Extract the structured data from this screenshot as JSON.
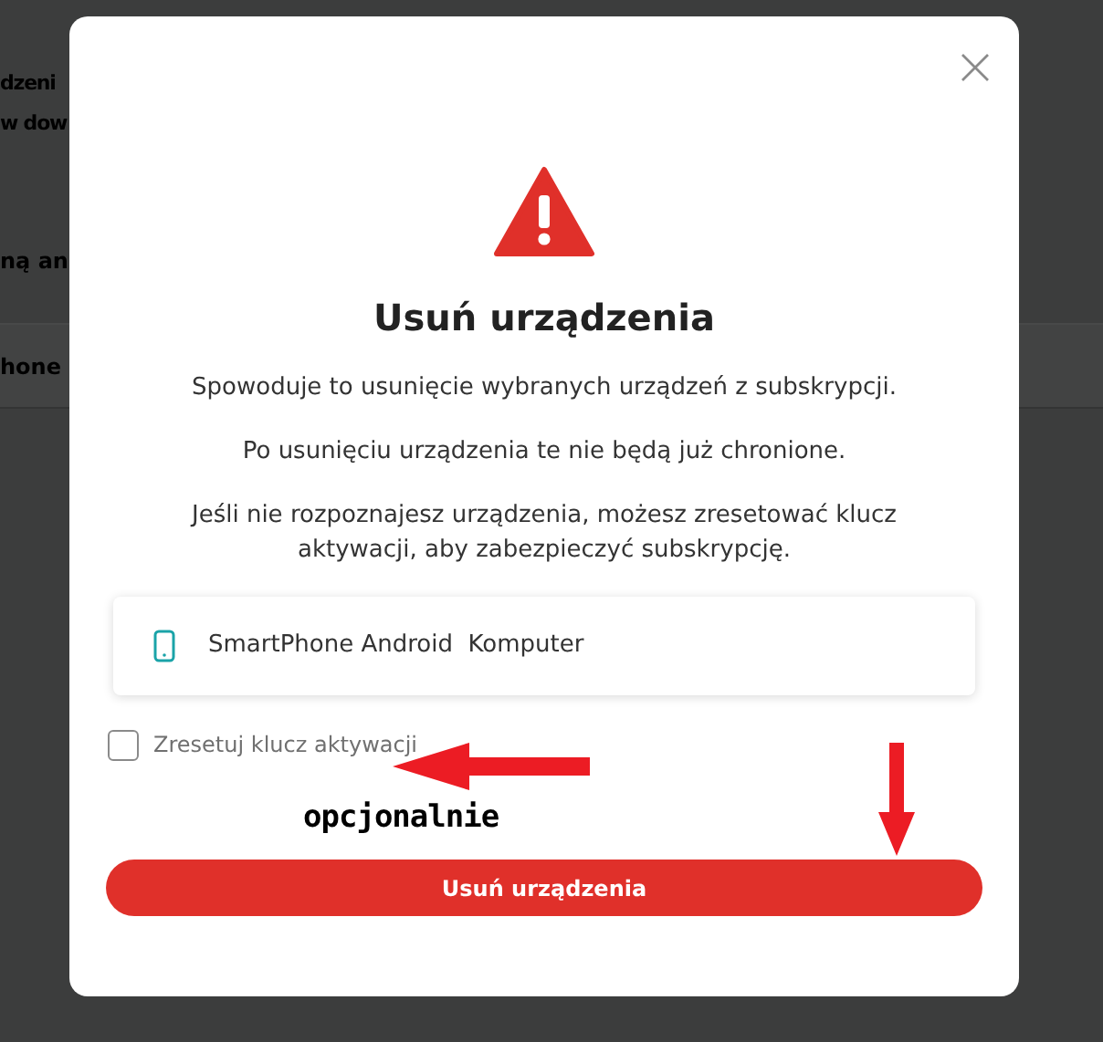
{
  "background_page": {
    "lines": [
      "dzeni",
      "w dow"
    ],
    "section_label": "ną an",
    "device_row": "hone"
  },
  "dialog": {
    "title": "Usuń urządzenia",
    "paragraphs": [
      "Spowoduje to usunięcie wybranych urządzeń z subskrypcji.",
      "Po usunięciu urządzenia te nie będą już chronione.",
      "Jeśli nie rozpoznajesz urządzenia, możesz zresetować klucz aktywacji, aby zabezpieczyć subskrypcję."
    ],
    "devices": [
      {
        "name": "SmartPhone Android  Komputer"
      }
    ],
    "reset_key": {
      "label": "Zresetuj klucz aktywacji",
      "checked": false
    },
    "confirm_button": "Usuń urządzenia"
  },
  "annotations": {
    "note": "opcjonalnie"
  }
}
